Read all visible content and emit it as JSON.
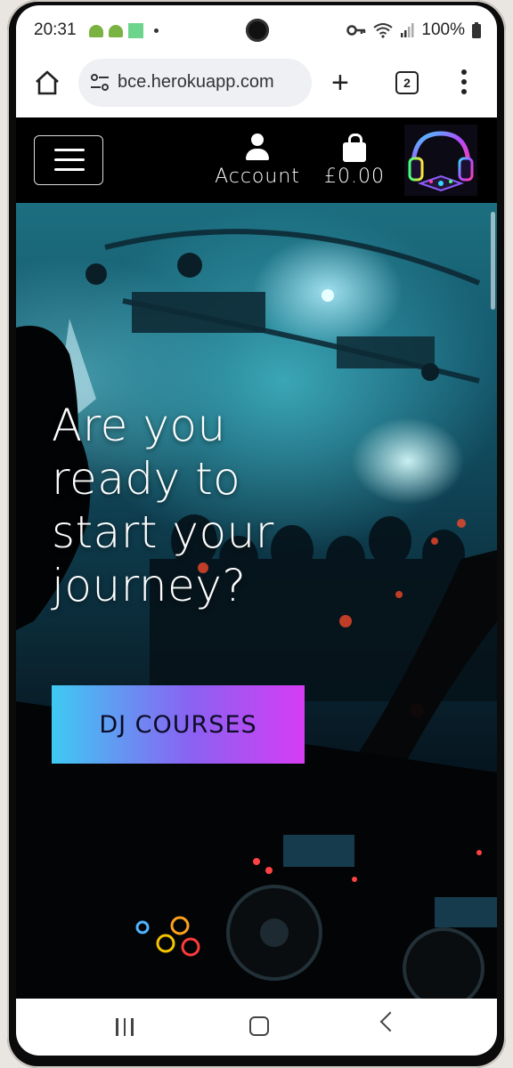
{
  "status_bar": {
    "time": "20:31",
    "battery": "100%",
    "icons": [
      "android-icon",
      "android-icon",
      "app-square-icon",
      "dot-icon",
      "key-icon",
      "wifi-icon",
      "signal-icon",
      "battery-icon"
    ]
  },
  "browser": {
    "url": "bce.herokuapp.com",
    "tab_count": "2",
    "new_tab_label": "+",
    "icons": [
      "home-icon",
      "site-settings-icon",
      "plus-icon",
      "tabs-icon",
      "more-menu-icon"
    ]
  },
  "header": {
    "account_label": "Account",
    "cart_total": "£0.00",
    "icons": [
      "hamburger-menu-icon",
      "account-icon",
      "shopping-bag-icon",
      "headphones-logo"
    ]
  },
  "hero": {
    "headline": "Are you ready to start your journey?",
    "cta_label": "DJ COURSES"
  },
  "colors": {
    "cta_gradient_start": "#3fc9f2",
    "cta_gradient_end": "#d63cf3",
    "header_bg": "#000000",
    "hero_tint": "#1c6f80"
  },
  "nav_bar": {
    "icons": [
      "recent-apps-icon",
      "home-button-icon",
      "back-icon"
    ]
  }
}
